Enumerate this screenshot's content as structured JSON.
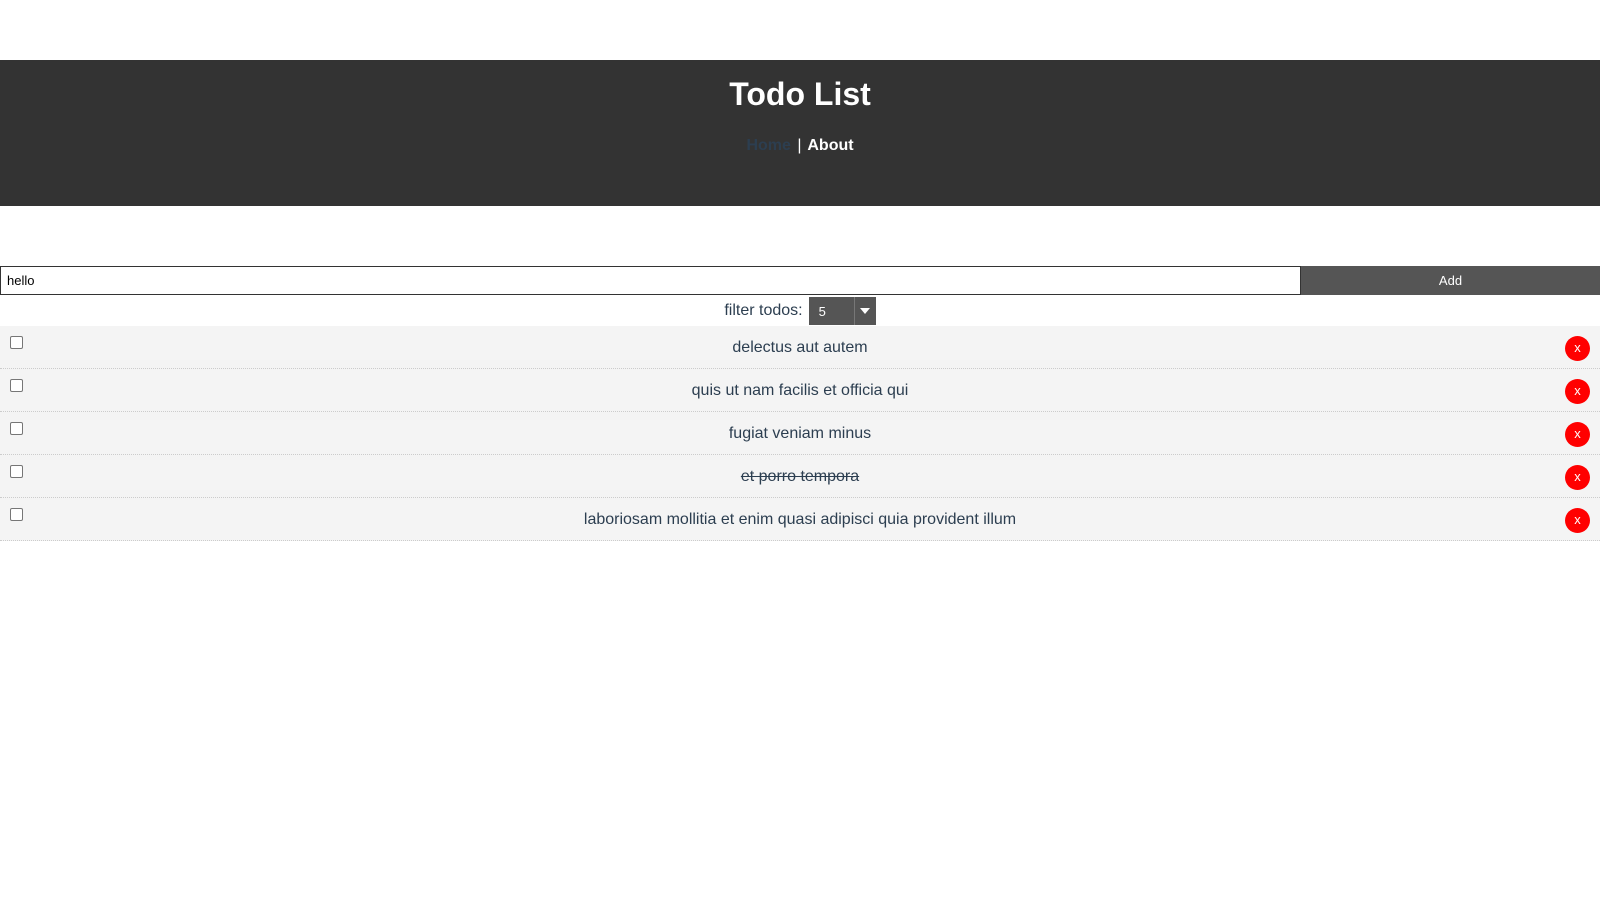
{
  "header": {
    "title": "Todo List",
    "nav": {
      "home": "Home",
      "separator": "|",
      "about": "About"
    }
  },
  "add_form": {
    "input_value": "hello",
    "add_label": "Add"
  },
  "filter": {
    "label": "filter todos:",
    "selected": "5"
  },
  "todos": [
    {
      "title": "delectus aut autem",
      "completed": false,
      "delete_label": "x"
    },
    {
      "title": "quis ut nam facilis et officia qui",
      "completed": false,
      "delete_label": "x"
    },
    {
      "title": "fugiat veniam minus",
      "completed": false,
      "delete_label": "x"
    },
    {
      "title": "et porro tempora",
      "completed": true,
      "delete_label": "x"
    },
    {
      "title": "laboriosam mollitia et enim quasi adipisci quia provident illum",
      "completed": false,
      "delete_label": "x"
    }
  ],
  "colors": {
    "header_bg": "#333333",
    "button_bg": "#555555",
    "delete_bg": "#ff0000",
    "todo_bg": "#f4f4f4",
    "text": "#2c3e50"
  }
}
